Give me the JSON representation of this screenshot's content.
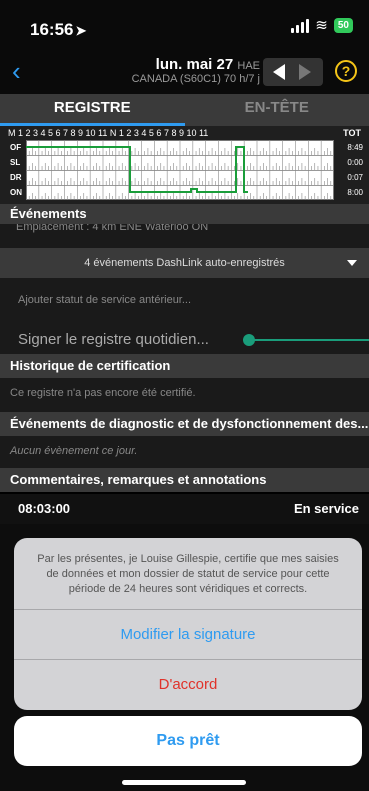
{
  "status_bar": {
    "time": "16:56",
    "battery": "50"
  },
  "header": {
    "date": "lun. mai 27",
    "timezone": "HAE",
    "subtitle": "CANADA (S60C1) 70 h/7 j",
    "help_label": "?"
  },
  "tabs": [
    {
      "label": "REGISTRE",
      "active": true
    },
    {
      "label": "EN-TÊTE",
      "active": false
    }
  ],
  "graph": {
    "hour_labels": "M  1  2  3  4  5  6  7  8  9  10 11  N  1  2  3  4  5  6  7  8  9  10 11",
    "total_label": "TOT",
    "rows": [
      {
        "label": "OF",
        "total": "8:49"
      },
      {
        "label": "SL",
        "total": "0:00"
      },
      {
        "label": "DR",
        "total": "0:07"
      },
      {
        "label": "ON",
        "total": "8:00"
      }
    ],
    "line_color": "#1a9d3a"
  },
  "events_header": "Événements",
  "location_line": "Emplacement :  4 km ENE Waterloo ON",
  "dashlink_label": "4 événements DashLink auto-enregistrés",
  "add_status": "Ajouter statut de service antérieur...",
  "sign_label": "Signer le registre quotidien...",
  "cert_header": "Historique de certification",
  "cert_text": "Ce registre n'a pas encore été certifié.",
  "diag_header": "Événements de diagnostic et de dysfonctionnement des...",
  "diag_text": "Aucun évènement ce jour.",
  "comments_header": "Commentaires, remarques et annotations",
  "comment": {
    "time": "08:03:00",
    "status": "En service"
  },
  "sheet": {
    "message": "Par les présentes, je Louise Gillespie, certifie que mes saisies de données et mon dossier de statut de service pour cette période de 24 heures sont véridiques et corrects.",
    "modify_label": "Modifier la signature",
    "agree_label": "D'accord",
    "cancel_label": "Pas prêt"
  }
}
